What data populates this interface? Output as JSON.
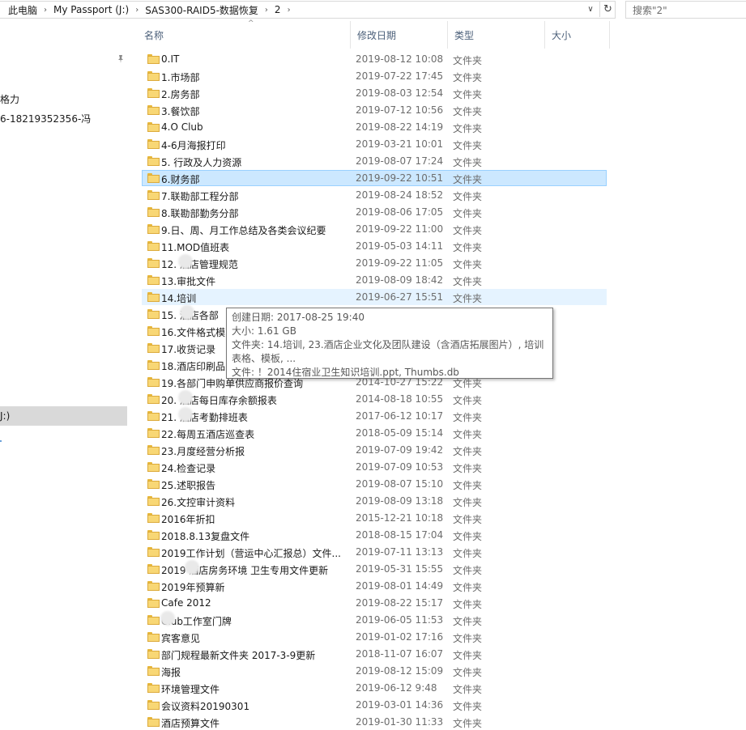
{
  "address": {
    "crumbs": [
      "此电脑",
      "My Passport (J:)",
      "SAS300-RAID5-数据恢复",
      "2"
    ],
    "separator": "›",
    "dropdown": "∨",
    "refresh": "↻"
  },
  "search": {
    "placeholder": "搜索\"2\""
  },
  "nav": {
    "items": [
      "格力",
      "6-18219352356-冯"
    ],
    "selected": "J:)",
    "pin": "📌"
  },
  "columns": {
    "name": "名称",
    "date": "修改日期",
    "type": "类型",
    "size": "大小",
    "sort_arrow": "^"
  },
  "files": [
    {
      "name": "0.IT",
      "date": "2019-08-12 10:08",
      "type": "文件夹"
    },
    {
      "name": "1.市场部",
      "date": "2019-07-22 17:45",
      "type": "文件夹"
    },
    {
      "name": "2.房务部",
      "date": "2019-08-03 12:54",
      "type": "文件夹"
    },
    {
      "name": "3.餐饮部",
      "date": "2019-07-12 10:56",
      "type": "文件夹"
    },
    {
      "name": "4.O Club",
      "date": "2019-08-22 14:19",
      "type": "文件夹"
    },
    {
      "name": "4-6月海报打印",
      "date": "2019-03-21 10:01",
      "type": "文件夹"
    },
    {
      "name": "5. 行政及人力资源",
      "date": "2019-08-07 17:24",
      "type": "文件夹"
    },
    {
      "name": "6.财务部",
      "date": "2019-09-22 10:51",
      "type": "文件夹"
    },
    {
      "name": "7.联勘部工程分部",
      "date": "2019-08-24 18:52",
      "type": "文件夹"
    },
    {
      "name": "8.联勘部勤务分部",
      "date": "2019-08-06 17:05",
      "type": "文件夹"
    },
    {
      "name": "9.日、周、月工作总结及各类会议纪要",
      "date": "2019-09-22 11:00",
      "type": "文件夹"
    },
    {
      "name": "11.MOD值班表",
      "date": "2019-05-03 14:11",
      "type": "文件夹"
    },
    {
      "name": "12.  酒店管理规范",
      "date": "2019-09-22 11:05",
      "type": "文件夹"
    },
    {
      "name": "13.审批文件",
      "date": "2019-08-09 18:42",
      "type": "文件夹"
    },
    {
      "name": "14.培训",
      "date": "2019-06-27 15:51",
      "type": "文件夹"
    },
    {
      "name": "15.  酒店各部",
      "date": "",
      "type": ""
    },
    {
      "name": "16.文件格式模",
      "date": "",
      "type": ""
    },
    {
      "name": "17.收货记录",
      "date": "",
      "type": ""
    },
    {
      "name": "18.酒店印刷品",
      "date": "",
      "type": ""
    },
    {
      "name": "19.各部门申购单供应商报价查询",
      "date": "2014-10-27 15:22",
      "type": "文件夹"
    },
    {
      "name": "20.  酒店每日库存余额报表",
      "date": "2014-08-18 10:55",
      "type": "文件夹"
    },
    {
      "name": "21.  酒店考勤排班表",
      "date": "2017-06-12 10:17",
      "type": "文件夹"
    },
    {
      "name": "22.每周五酒店巡查表",
      "date": "2018-05-09 15:14",
      "type": "文件夹"
    },
    {
      "name": "23.月度经营分析报",
      "date": "2019-07-09 19:42",
      "type": "文件夹"
    },
    {
      "name": "24.检查记录",
      "date": "2019-07-09 10:53",
      "type": "文件夹"
    },
    {
      "name": "25.述职报告",
      "date": "2019-08-07 15:10",
      "type": "文件夹"
    },
    {
      "name": "26.文控审计资料",
      "date": "2019-08-09 13:18",
      "type": "文件夹"
    },
    {
      "name": "2016年折扣",
      "date": "2015-12-21 10:18",
      "type": "文件夹"
    },
    {
      "name": "2018.8.13复盘文件",
      "date": "2018-08-15 17:04",
      "type": "文件夹"
    },
    {
      "name": "2019工作计划（营运中心汇报总）文件...",
      "date": "2019-07-11 13:13",
      "type": "文件夹"
    },
    {
      "name": "2019  酒店房务环境 卫生专用文件更新",
      "date": "2019-05-31 15:55",
      "type": "文件夹"
    },
    {
      "name": "2019年预算新",
      "date": "2019-08-01 14:49",
      "type": "文件夹"
    },
    {
      "name": "Cafe 2012",
      "date": "2019-08-22 15:17",
      "type": "文件夹"
    },
    {
      "name": "  Club工作室门牌",
      "date": "2019-06-05 11:53",
      "type": "文件夹"
    },
    {
      "name": "宾客意见",
      "date": "2019-01-02 17:16",
      "type": "文件夹"
    },
    {
      "name": "部门规程最新文件夹 2017-3-9更新",
      "date": "2018-11-07 16:07",
      "type": "文件夹"
    },
    {
      "name": "海报",
      "date": "2019-08-12 15:09",
      "type": "文件夹"
    },
    {
      "name": "环境管理文件",
      "date": "2019-06-12 9:48",
      "type": "文件夹"
    },
    {
      "name": "会议资料20190301",
      "date": "2019-03-01 14:36",
      "type": "文件夹"
    },
    {
      "name": "酒店预算文件",
      "date": "2019-01-30 11:33",
      "type": "文件夹"
    }
  ],
  "tooltip": {
    "created": "创建日期: 2017-08-25 19:40",
    "size": "大小: 1.61 GB",
    "folders": "文件夹: 14.培训, 23.酒店企业文化及团队建设（含酒店拓展图片）, 培训表格、模板, ...",
    "files": "文件: ！2014住宿业卫生知识培训.ppt, Thumbs.db"
  }
}
